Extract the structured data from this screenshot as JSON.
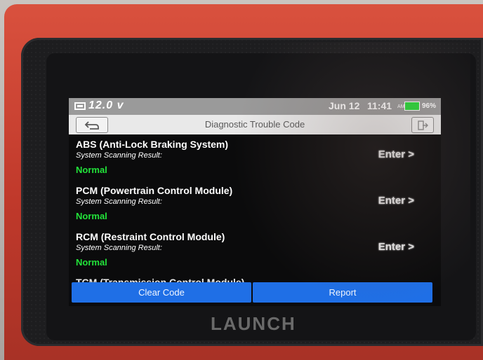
{
  "status_bar": {
    "voltage": "12.0 v",
    "date": "Jun 12",
    "time": "11:41",
    "ampm": "AM",
    "battery_percent": "96%",
    "battery_color": "#28d93a"
  },
  "header": {
    "title": "Diagnostic Trouble Code",
    "back_icon": "back-arrow-icon",
    "exit_icon": "exit-icon"
  },
  "modules": [
    {
      "name": "ABS (Anti-Lock Braking System)",
      "scan_label": "System Scanning Result:",
      "result": "Normal",
      "enter_label": "Enter >"
    },
    {
      "name": "PCM (Powertrain Control Module)",
      "scan_label": "System Scanning Result:",
      "result": "Normal",
      "enter_label": "Enter >"
    },
    {
      "name": "RCM (Restraint Control Module)",
      "scan_label": "System Scanning Result:",
      "result": "Normal",
      "enter_label": "Enter >"
    },
    {
      "name": "TCM (Transmission Control Module)"
    }
  ],
  "actions": {
    "clear_code": "Clear Code",
    "report": "Report",
    "button_color": "#1f6fe6"
  },
  "device": {
    "brand": "LAUNCH",
    "case_color": "#c0392b"
  }
}
